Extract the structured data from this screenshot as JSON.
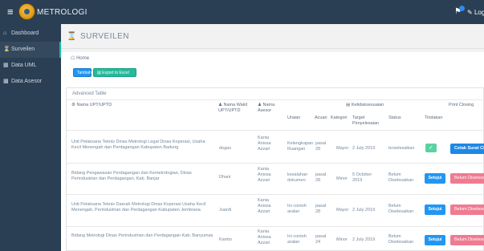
{
  "header": {
    "app_title": "METROLOGI",
    "logout_label": "Log"
  },
  "sidebar": {
    "items": [
      {
        "label": "Dashboard",
        "icon": "home-icon"
      },
      {
        "label": "Surveilen",
        "icon": "hourglass-icon"
      },
      {
        "label": "Data UML",
        "icon": "chart-icon"
      },
      {
        "label": "Data Asesor",
        "icon": "users-icon"
      }
    ]
  },
  "page": {
    "title": "SURVEILEN",
    "breadcrumb": "Home",
    "btn_tambah": "Tambah",
    "btn_export": "Export to Excel",
    "table_caption": "Advanced Table"
  },
  "table": {
    "headers": {
      "nama_upt": "Nama UPT/UPTD",
      "nama_wakil": "Nama Wakil UPT/UPTD",
      "nama_asesor": "Nama Asesor",
      "ketidaksesuaian": "Ketidaksesuaian",
      "print": "Print Closing",
      "uraian": "Uraian",
      "acuan": "Acuan",
      "kategori": "Kategori",
      "target": "Target Penyelesaian",
      "status": "Status",
      "tindakan": "Tindakan"
    },
    "rows": [
      {
        "upt": "Unit Pelaksana Teknis Dinas Metrologi Legal Dinas Koperasi, Usaha Kecil Menengah dan Perdagangan Kabupaten Badung",
        "wakil": "dogas",
        "asesor": "Kania Anissa Azzari",
        "uraian": "Kelengkapan Ruangan",
        "acuan": "pasal 28",
        "kategori": "Mayor",
        "target": "2 July 2019",
        "status": "terselesaikan",
        "tindakan_type": "check",
        "print_label": "Cetak Surat Clo"
      },
      {
        "upt": "Bidang Pengawasan Perdagangan dan Kemetrologian, Dinas Perindustrian dan Perdagangan, Kab. Banjar",
        "wakil": "Dhani",
        "asesor": "Kania Anissa Azzari",
        "uraian": "kesalahan dokumen",
        "acuan": "pasal 28",
        "kategori": "Minor",
        "target": "5 October 2019",
        "status": "Belum Diselesaikan",
        "tindakan_label": "Setujui",
        "print_label": "Belum Diselesa"
      },
      {
        "upt": "Unit Pelaksana Teknis Daerah Metrologi Dinas Koperasi Usaha Kecil Menengah, Perindustrian dan Perdagangan Kabupaten Jembrana",
        "wakil": "Juardi",
        "asesor": "Kania Anissa Azzari",
        "uraian": "Ini contoh aralan",
        "acuan": "pasal 28",
        "kategori": "Mayor",
        "target": "2 July 2019",
        "status": "Belum Diselesaikan",
        "tindakan_label": "Setujui",
        "print_label": "Belum Diselesa"
      },
      {
        "upt": "Bidang Metrologi Dinas Perindustrian dan Perdagangan Kab. Banyumas",
        "wakil": "Kamto",
        "asesor": "Kania Anissa Azzari",
        "uraian": "Ini contoh aralan",
        "acuan": "pasal 24",
        "kategori": "Minor",
        "target": "2 July 2019",
        "status": "Belum Diselesaikan",
        "tindakan_label": "Setujui",
        "print_label": "Belum Diselesa"
      }
    ]
  }
}
